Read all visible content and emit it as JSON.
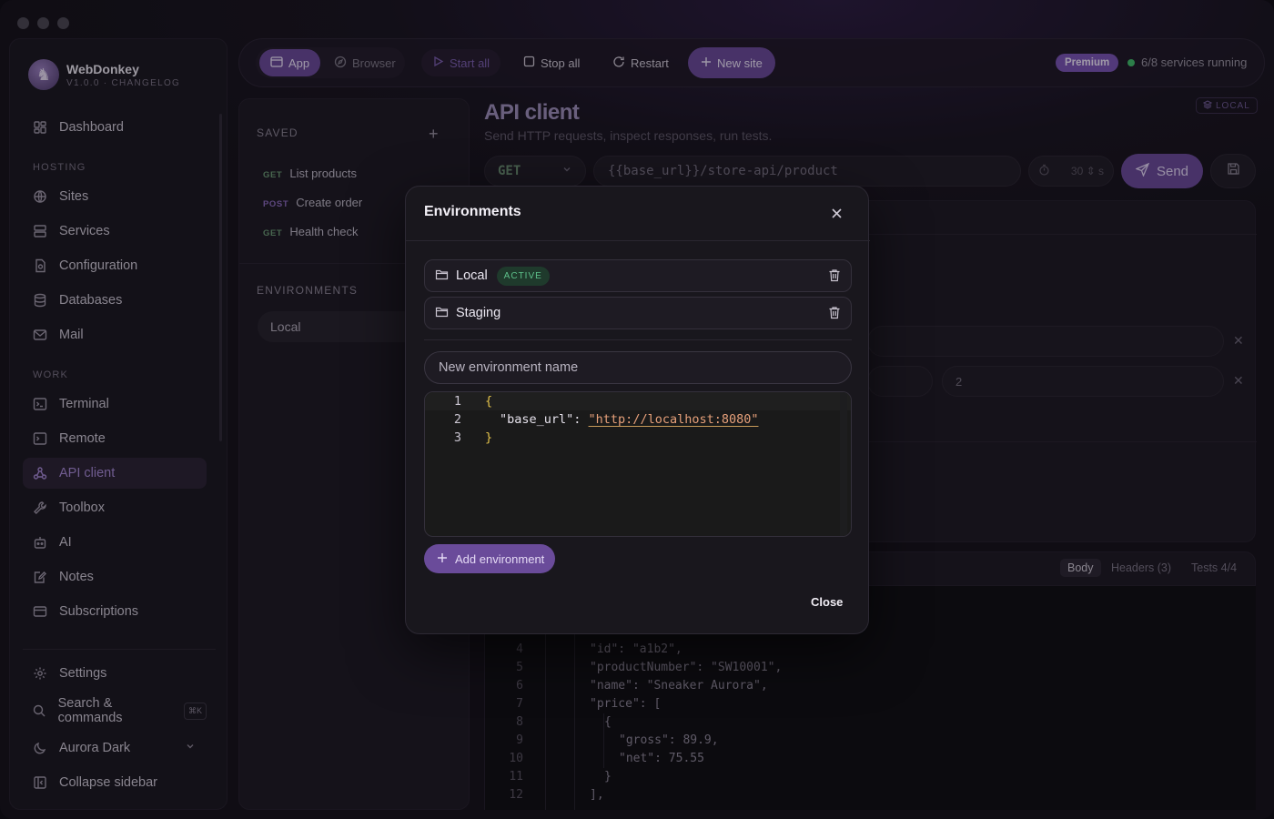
{
  "app": {
    "name": "WebDonkey",
    "version": "V1.0.0 · CHANGELOG"
  },
  "sidebar": {
    "dashboard": "Dashboard",
    "sections": {
      "hosting": "HOSTING",
      "work": "WORK"
    },
    "hosting_items": [
      "Sites",
      "Services",
      "Configuration",
      "Databases",
      "Mail"
    ],
    "work_items": [
      "Terminal",
      "Remote",
      "API client",
      "Toolbox",
      "AI",
      "Notes",
      "Subscriptions"
    ],
    "settings": "Settings",
    "search": "Search & commands",
    "search_shortcut": "⌘K",
    "theme": "Aurora Dark",
    "collapse": "Collapse sidebar"
  },
  "toolbar": {
    "app": "App",
    "browser": "Browser",
    "start_all": "Start all",
    "stop_all": "Stop all",
    "restart": "Restart",
    "new_site": "New site",
    "premium": "Premium",
    "services_status": "6/8 services running"
  },
  "left_panel": {
    "saved_title": "SAVED",
    "saved": [
      {
        "method": "GET",
        "name": "List products"
      },
      {
        "method": "POST",
        "name": "Create order"
      },
      {
        "method": "GET",
        "name": "Health check"
      }
    ],
    "environments_title": "ENVIRONMENTS",
    "current_env": "Local"
  },
  "main": {
    "title": "API client",
    "subtitle": "Send HTTP requests, inspect responses, run tests.",
    "env_badge": "LOCAL",
    "method": "GET",
    "url": "{{base_url}}/store-api/product",
    "timeout_value": "30",
    "timeout_unit": "s",
    "send": "Send",
    "kv_value": "2",
    "response_tabs": {
      "body": "Body",
      "headers": "Headers (3)",
      "tests": "Tests 4/4"
    },
    "response_lines": [
      {
        "n": "4",
        "text": "\"id\": \"a1b2\","
      },
      {
        "n": "5",
        "text": "\"productNumber\": \"SW10001\","
      },
      {
        "n": "6",
        "text": "\"name\": \"Sneaker Aurora\","
      },
      {
        "n": "7",
        "text": "\"price\": ["
      },
      {
        "n": "8",
        "text": "{"
      },
      {
        "n": "9",
        "text": "\"gross\": 89.9,"
      },
      {
        "n": "10",
        "text": "\"net\": 75.55"
      },
      {
        "n": "11",
        "text": "}"
      },
      {
        "n": "12",
        "text": "],"
      }
    ]
  },
  "modal": {
    "title": "Environments",
    "environments": [
      {
        "name": "Local",
        "badge": "ACTIVE"
      },
      {
        "name": "Staging"
      }
    ],
    "new_env_placeholder": "New environment name",
    "editor_lines": [
      "1",
      "2",
      "3"
    ],
    "json_key": "\"base_url\"",
    "json_value": "\"http://localhost:8080\"",
    "add_button": "Add environment",
    "close_button": "Close"
  },
  "colors": {
    "accent": "#6a4b9a",
    "active_nav": "#a88ad8",
    "status_green": "#3fbf6a",
    "badge_green": "#5dc08a"
  }
}
